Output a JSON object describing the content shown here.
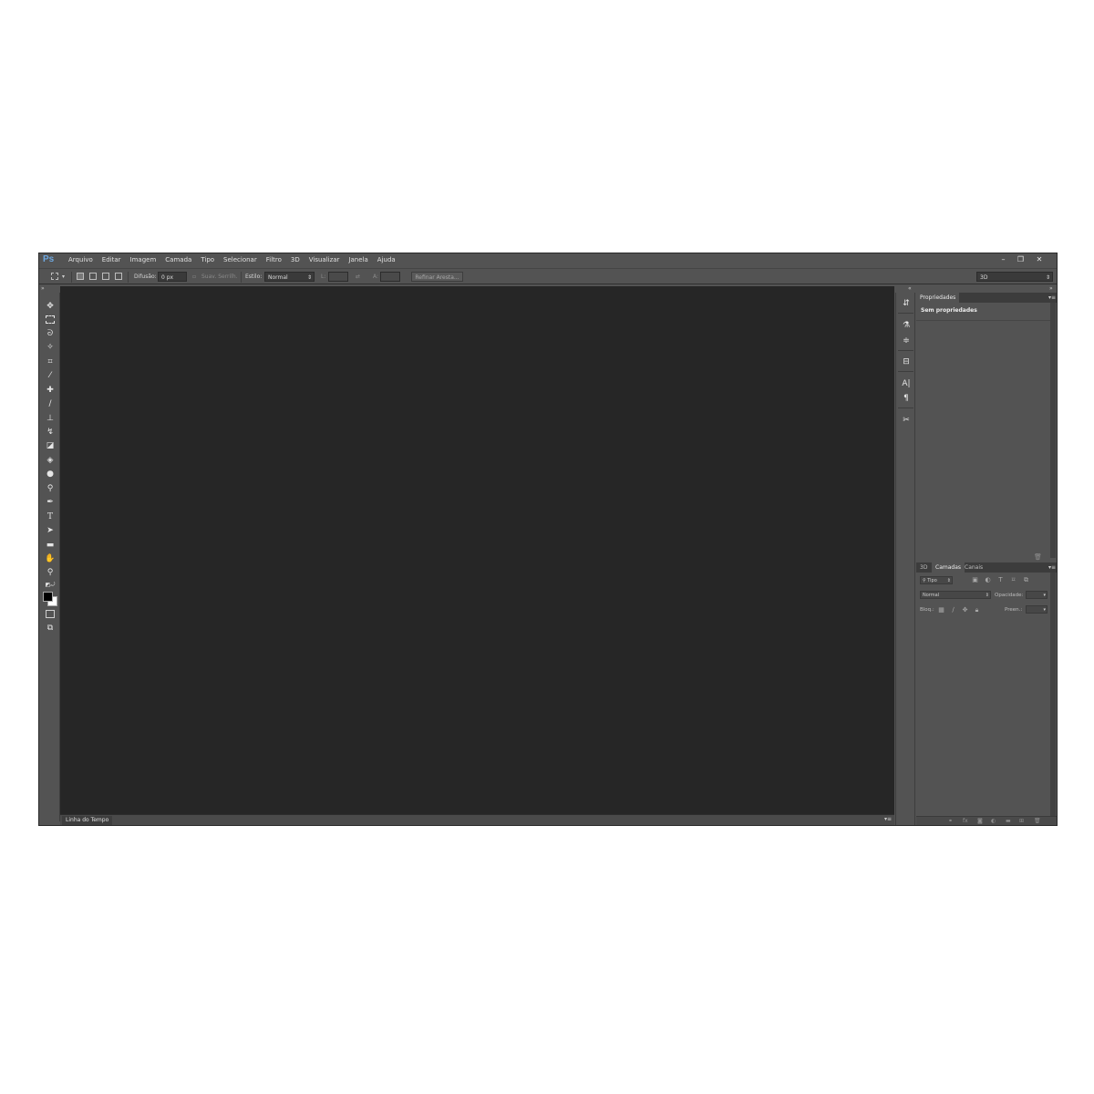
{
  "app": {
    "logo": "Ps"
  },
  "menu": [
    "Arquivo",
    "Editar",
    "Imagem",
    "Camada",
    "Tipo",
    "Selecionar",
    "Filtro",
    "3D",
    "Visualizar",
    "Janela",
    "Ajuda"
  ],
  "window_controls": {
    "minimize": "–",
    "restore": "❐",
    "close": "✕"
  },
  "options": {
    "feather_label": "Difusão:",
    "feather_value": "0 px",
    "antialias_label": "Suav. Serrilh.",
    "style_label": "Estilo:",
    "style_value": "Normal",
    "width_label": "L:",
    "height_label": "A:",
    "refine_button": "Refinar Aresta...",
    "workspace_value": "3D"
  },
  "collapse": {
    "left": "»",
    "right": "«",
    "far_right": "»"
  },
  "timeline": {
    "tab": "Linha do Tempo",
    "menu": "▾≡"
  },
  "properties": {
    "tab": "Propriedades",
    "menu": "▾≡",
    "empty_text": "Sem propriedades"
  },
  "layers": {
    "tabs": [
      "3D",
      "Camadas",
      "Canais"
    ],
    "menu": "▾≡",
    "filter_value": "Tipo",
    "blend_value": "Normal",
    "opacity_label": "Opacidade:",
    "lock_label": "Bloq.:",
    "fill_label": "Preen.:"
  },
  "icons": {
    "tools": [
      "move-icon",
      "marquee-icon",
      "lasso-icon",
      "quick-select-icon",
      "crop-icon",
      "eyedropper-icon",
      "healing-brush-icon",
      "brush-icon",
      "clone-stamp-icon",
      "history-brush-icon",
      "eraser-icon",
      "paint-bucket-icon",
      "blur-icon",
      "dodge-icon",
      "pen-icon",
      "type-icon",
      "path-select-icon",
      "rectangle-icon",
      "hand-icon",
      "zoom-icon"
    ],
    "strip": [
      "history-icon",
      "actions-icon",
      "adjustments-icon",
      "layer-comps-icon",
      "character-icon",
      "paragraph-icon",
      "tool-presets-icon"
    ]
  }
}
